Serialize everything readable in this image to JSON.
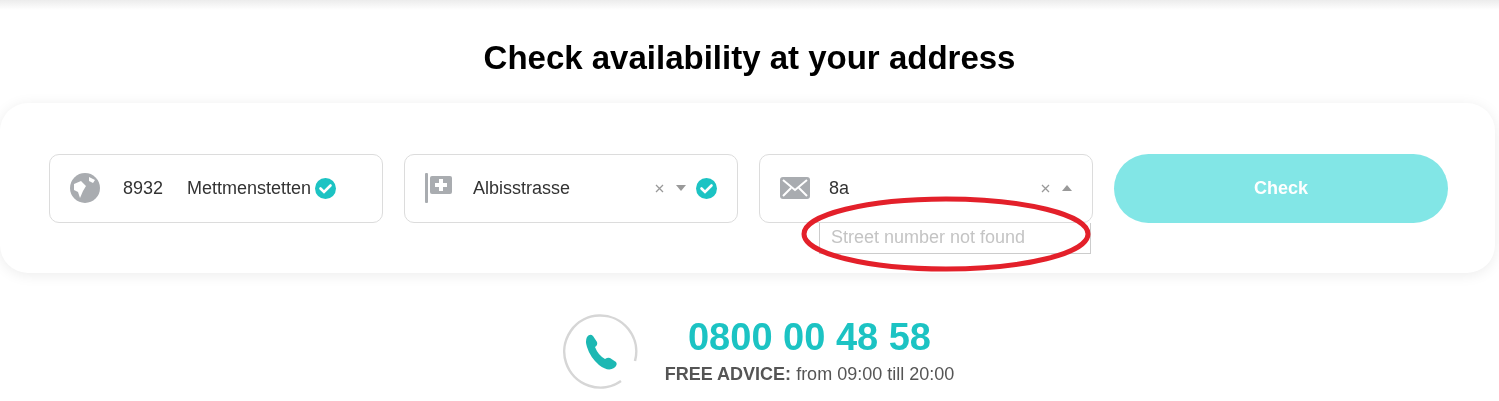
{
  "heading": "Check availability at your address",
  "fields": [
    {
      "kind": "postcode",
      "zip": "8932",
      "city": "Mettmenstetten",
      "verified": true
    },
    {
      "kind": "street",
      "value": "Albisstrasse",
      "expanded": false,
      "verified": true
    },
    {
      "kind": "number",
      "value": "8a",
      "expanded": true,
      "dropdown_message": "Street number not found"
    }
  ],
  "check_button": {
    "label": "Check",
    "disabled": true
  },
  "annotations": [
    {
      "kind": "ellipse",
      "color": "#e3202a"
    }
  ],
  "contact": {
    "phone": "0800 00 48 58",
    "advice_label": "FREE ADVICE:",
    "advice_hours": "from 09:00 till 20:00"
  }
}
